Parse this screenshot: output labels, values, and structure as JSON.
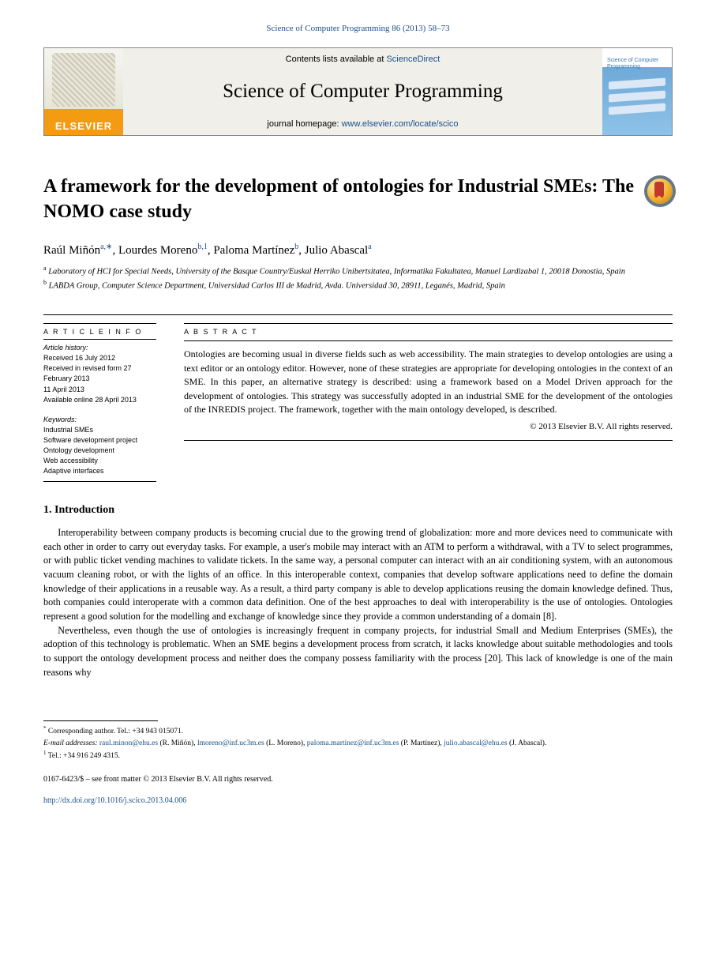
{
  "citation_top": "Science of Computer Programming 86 (2013) 58–73",
  "header": {
    "contents_prefix": "Contents lists available at ",
    "contents_link": "ScienceDirect",
    "journal_name": "Science of Computer Programming",
    "homepage_prefix": "journal homepage: ",
    "homepage_link": "www.elsevier.com/locate/scico",
    "publisher_logo_text": "ELSEVIER",
    "cover_title": "Science of Computer Programming"
  },
  "article": {
    "title": "A framework for the development of ontologies for Industrial SMEs: The NOMO case study",
    "authors": [
      {
        "name": "Raúl Miñón",
        "affs": "a,",
        "corr": "∗"
      },
      {
        "name": "Lourdes Moreno",
        "affs": "b,",
        "note": "1"
      },
      {
        "name": "Paloma Martínez",
        "affs": "b"
      },
      {
        "name": "Julio Abascal",
        "affs": "a"
      }
    ],
    "author_sep": ", ",
    "affiliations": [
      {
        "label": "a",
        "text": "Laboratory of HCI for Special Needs, University of the Basque Country/Euskal Herriko Unibertsitatea, Informatika Fakultatea, Manuel Lardizabal 1, 20018 Donostia, Spain"
      },
      {
        "label": "b",
        "text": "LABDA Group, Computer Science Department, Universidad Carlos III de Madrid, Avda. Universidad 30, 28911, Leganés, Madrid, Spain"
      }
    ]
  },
  "article_info": {
    "head": "A R T I C L E   I N F O",
    "received": "Received 16 July 2012",
    "revised": "Received in revised form 27 February 2013",
    "accepted": "11 April 2013",
    "available": "Available online 28 April 2013",
    "kw_head": "Keywords:",
    "keywords": [
      "Industrial SMEs",
      "Software development project",
      "Ontology development",
      "Web accessibility",
      "Adaptive interfaces"
    ]
  },
  "abstract": {
    "head": "A B S T R A C T",
    "text": "Ontologies are becoming usual in diverse fields such as web accessibility. The main strategies to develop ontologies are using a text editor or an ontology editor. However, none of these strategies are appropriate for developing ontologies in the context of an SME. In this paper, an alternative strategy is described: using a framework based on a Model Driven approach for the development of ontologies. This strategy was successfully adopted in an industrial SME for the development of the ontologies of the INREDIS project. The framework, together with the main ontology developed, is described.",
    "copyright": "© 2013 Elsevier B.V. All rights reserved."
  },
  "section1": {
    "head": "1. Introduction",
    "p1": "Interoperability between company products is becoming crucial due to the growing trend of globalization: more and more devices need to communicate with each other in order to carry out everyday tasks. For example, a user's mobile may interact with an ATM to perform a withdrawal, with a TV to select programmes, or with public ticket vending machines to validate tickets. In the same way, a personal computer can interact with an air conditioning system, with an autonomous vacuum cleaning robot, or with the lights of an office. In this interoperable context, companies that develop software applications need to define the domain knowledge of their applications in a reusable way. As a result, a third party company is able to develop applications reusing the domain knowledge defined. Thus, both companies could interoperate with a common data definition. One of the best approaches to deal with interoperability is the use of ontologies. Ontologies represent a good solution for the modelling and exchange of knowledge since they provide a common understanding of a domain [8].",
    "p2": "Nevertheless, even though the use of ontologies is increasingly frequent in company projects, for industrial Small and Medium Enterprises (SMEs), the adoption of this technology is problematic. When an SME begins a development process from scratch, it lacks knowledge about suitable methodologies and tools to support the ontology development process and neither does the company possess familiarity with the process [20]. This lack of knowledge is one of the main reasons why"
  },
  "footnotes": {
    "corr_label": "*",
    "corr_text": "Corresponding author. Tel.: +34 943 015071.",
    "emails_label": "E-mail addresses:",
    "emails": [
      {
        "addr": "raul.minon@ehu.es",
        "who": "(R. Miñón)"
      },
      {
        "addr": "lmoreno@inf.uc3m.es",
        "who": "(L. Moreno)"
      },
      {
        "addr": "paloma.martinez@inf.uc3m.es",
        "who": "(P. Martínez)"
      },
      {
        "addr": "julio.abascal@ehu.es",
        "who": "(J. Abascal)"
      }
    ],
    "note1_label": "1",
    "note1_text": "Tel.: +34 916 249 4315.",
    "issn": "0167-6423/$ – see front matter © 2013 Elsevier B.V. All rights reserved.",
    "doi": "http://dx.doi.org/10.1016/j.scico.2013.04.006"
  }
}
